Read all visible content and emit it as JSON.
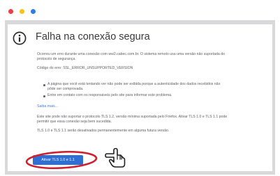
{
  "window": {
    "traffic_lights": {
      "close": "#ef3b4a",
      "minimize": "#f7c21a",
      "zoom": "#2f7de1"
    }
  },
  "error_page": {
    "icon": "info-icon",
    "title": "Falha na conexão segura",
    "paragraph_1_line_1": "Ocorreu um erro durante uma conexão com ww2.cabec.com.br. O sistema remoto usa uma versão não suportada do",
    "paragraph_1_line_2": "protocolo de segurança.",
    "error_code": "Código do erro: SSL_ERROR_UNSUPPORTED_VERSION",
    "bullet_1_line_1": "A página que você está tentando ver não pode ser exibida porque a autenticidade dos dados recebidos não",
    "bullet_1_line_2": "pôde ser comprovada.",
    "bullet_2": "Entre em contato com os responsáveis pelo site para informar este problema.",
    "learn_more": "Saiba mais...",
    "paragraph_2_line_1": "Este site pode não suportar o protocolo TLS 1.2, versão mínima suportada pelo Firefox. Ativar TLS 1.0 e TLS 1.1 pode",
    "paragraph_2_line_2": "permitir que essa conexão seja bem sucedida.",
    "paragraph_3": "TLS 1.0 e TLS 1.1 serão desativados permanentemente em alguma futura versão.",
    "activate_button": "Ativar TLS 1.0 e 1.1"
  },
  "annotation": {
    "ellipse_color": "#d0202f",
    "pointer": "hand-pointer-icon"
  }
}
